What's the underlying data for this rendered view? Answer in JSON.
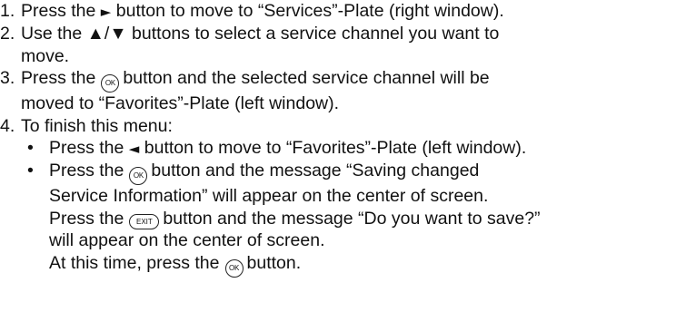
{
  "steps": [
    {
      "number": "1.",
      "before": "Press the",
      "icon": "right-triangle-icon",
      "glyph": "►",
      "after": "button to move to “Services”-Plate (right window)."
    },
    {
      "number": "2.",
      "line1": "Use the ▲/▼ buttons to select a service channel you want to",
      "line2": "move."
    },
    {
      "number": "3.",
      "before": "Press the",
      "ok_label": "OK",
      "after": "button and the selected service channel will be",
      "line2": "moved to “Favorites”-Plate (left window)."
    },
    {
      "number": "4.",
      "text": "To finish this menu:",
      "bullets": [
        {
          "dot": "•",
          "before": "Press the",
          "glyph": "◄",
          "after": "button to move to “Favorites”-Plate (left window)."
        },
        {
          "dot": "•",
          "l1_before": "Press the",
          "ok_label": "OK",
          "l1_after": "button and the message “Saving changed",
          "l2": "Service Information” will appear on the center of screen.",
          "l3_before": "Press the",
          "exit_label": "EXIT",
          "l3_after": "button and the message “Do you want to save?”",
          "l4": "will appear on the center of screen.",
          "l5_before": "At this time, press the",
          "ok_label2": "OK",
          "l5_after": "button."
        }
      ]
    }
  ]
}
